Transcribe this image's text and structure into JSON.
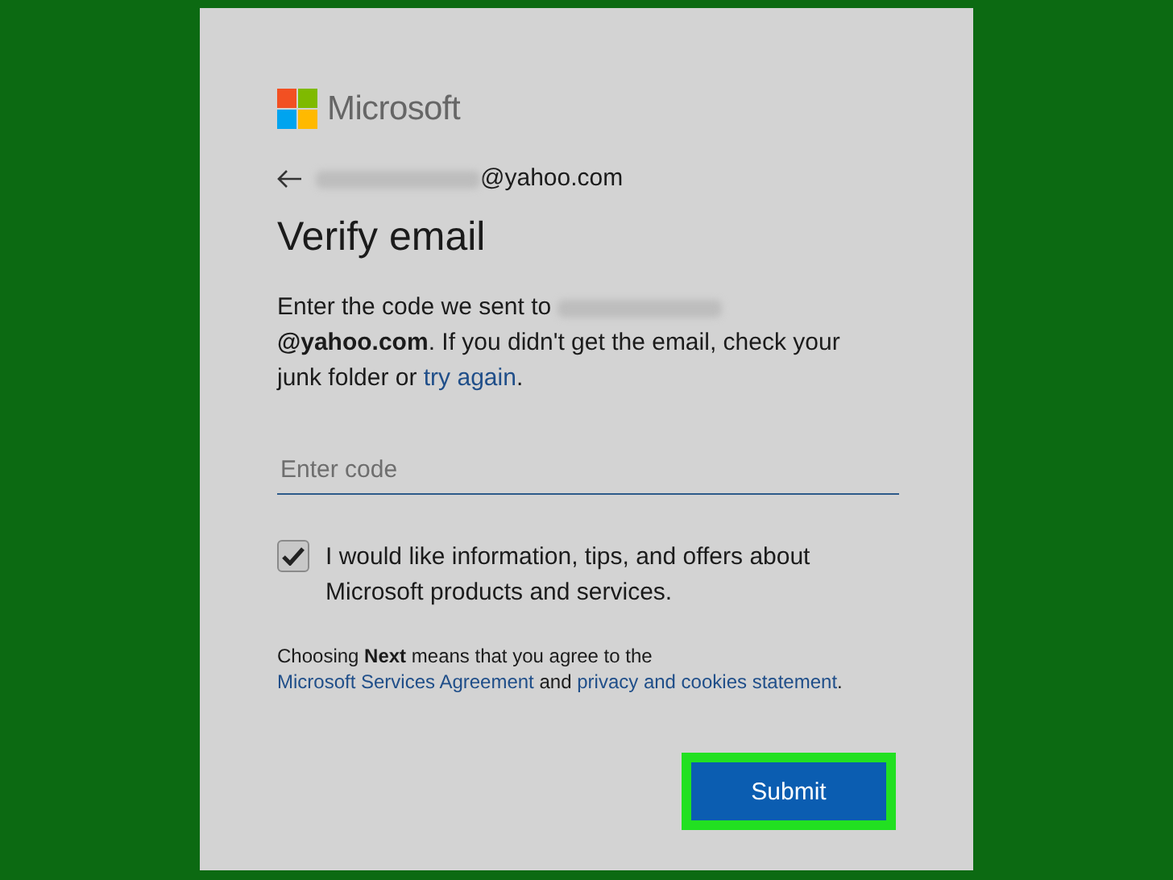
{
  "brand": {
    "name": "Microsoft"
  },
  "identity": {
    "email": "@yahoo.com"
  },
  "title": "Verify email",
  "message": [
    {
      "kind": "text",
      "text": "Enter the code we sent to "
    },
    {
      "kind": "redacted"
    },
    {
      "kind": "text",
      "text": "**@yahoo.com**. If you didn't get the email, check your junk folder or "
    },
    {
      "kind": "link",
      "text": "try again"
    },
    {
      "kind": "text",
      "text": "."
    }
  ],
  "code_field": {
    "placeholder": "Enter code"
  },
  "opt_in": {
    "label": "I would like information, tips, and offers about Microsoft products and services.",
    "checked": true
  },
  "terms": [
    {
      "kind": "text",
      "text": "Choosing **Next** means that you agree to the "
    },
    {
      "kind": "link",
      "text": "Microsoft Services Agreement"
    },
    {
      "kind": "text",
      "text": " and "
    },
    {
      "kind": "link",
      "text": "privacy and cookies statement"
    },
    {
      "kind": "text",
      "text": "."
    }
  ],
  "submit": {
    "label": "Submit",
    "highlighted": true
  }
}
